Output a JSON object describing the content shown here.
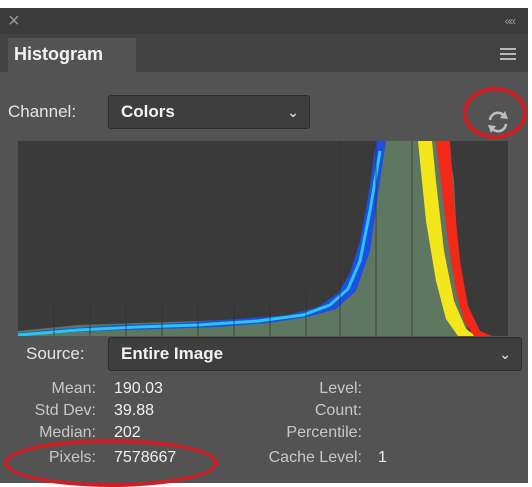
{
  "panel": {
    "close_glyph": "×",
    "collapse_glyph": "««",
    "tab_label": "Histogram",
    "menu_icon": "panel-menu-icon"
  },
  "channel": {
    "label": "Channel:",
    "value": "Colors",
    "refresh_icon": "refresh-icon"
  },
  "source": {
    "label": "Source:",
    "value": "Entire Image"
  },
  "stats": {
    "mean_label": "Mean:",
    "mean_value": "190.03",
    "std_label": "Std Dev:",
    "std_value": "39.88",
    "median_label": "Median:",
    "median_value": "202",
    "pixels_label": "Pixels:",
    "pixels_value": "7578667",
    "level_label": "Level:",
    "count_label": "Count:",
    "percentile_label": "Percentile:",
    "cache_label": "Cache Level:",
    "cache_value": "1"
  },
  "colors": {
    "highlight": "#d11e24",
    "blue": "#1e4fe0",
    "cyan": "#27c6f0",
    "gray_green": "#5e7760",
    "yellow": "#f3e61a",
    "red": "#f22818"
  }
}
